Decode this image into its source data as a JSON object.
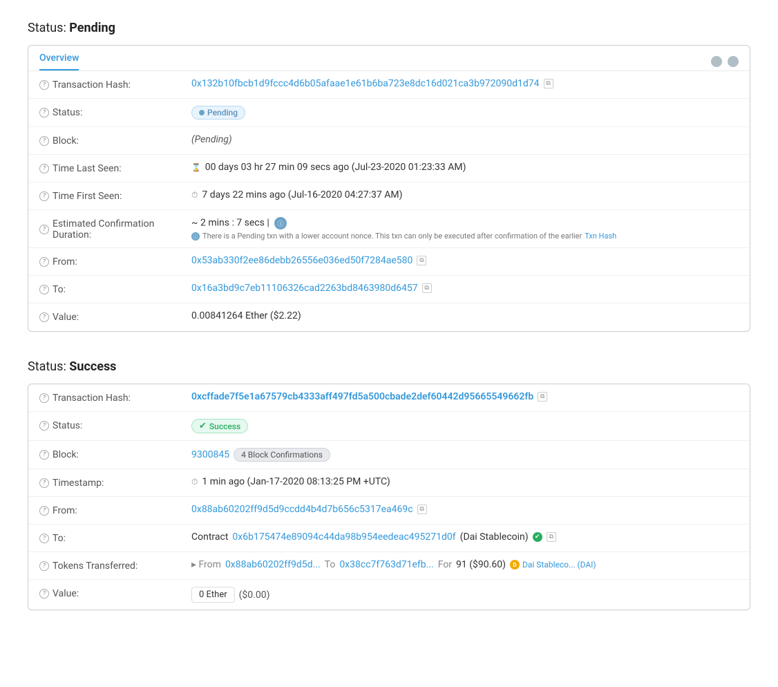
{
  "pending_section": {
    "title": "Status:",
    "title_bold": "Pending",
    "tab_label": "Overview",
    "transaction_hash_label": "Transaction Hash:",
    "transaction_hash_value": "0x132b10fbcb1d9fccc4d6b05afaae1e61b6ba723e8dc16d021ca3b972090d1d74",
    "status_label": "Status:",
    "status_value": "Pending",
    "block_label": "Block:",
    "block_value": "(Pending)",
    "time_last_seen_label": "Time Last Seen:",
    "time_last_seen_value": "00 days 03 hr 27 min 09 secs ago (Jul-23-2020 01:23:33 AM)",
    "time_first_seen_label": "Time First Seen:",
    "time_first_seen_value": "7 days 22 mins ago (Jul-16-2020 04:27:37 AM)",
    "est_confirmation_label": "Estimated Confirmation Duration:",
    "est_confirmation_value": "~ 2 mins : 7 secs |",
    "est_confirmation_note": "There is a Pending txn with a lower account nonce. This txn can only be executed after confirmation of the earlier",
    "est_confirmation_note_link": "Txn Hash",
    "from_label": "From:",
    "from_value": "0x53ab330f2ee86debb26556e036ed50f7284ae580",
    "to_label": "To:",
    "to_value": "0x16a3bd9c7eb11106326cad2263bd8463980d6457",
    "value_label": "Value:",
    "value_value": "0.00841264 Ether ($2.22)"
  },
  "success_section": {
    "title": "Status:",
    "title_bold": "Success",
    "transaction_hash_label": "Transaction Hash:",
    "transaction_hash_value": "0xcffade7f5e1a67579cb4333aff497fd5a500cbade2def60442d95665549662fb",
    "status_label": "Status:",
    "status_value": "Success",
    "block_label": "Block:",
    "block_number": "9300845",
    "block_confirmations": "4 Block Confirmations",
    "timestamp_label": "Timestamp:",
    "timestamp_value": "1 min ago (Jan-17-2020 08:13:25 PM +UTC)",
    "from_label": "From:",
    "from_value": "0x88ab60202ff9d5d9ccdd4b4d7b656c5317ea469c",
    "to_label": "To:",
    "to_prefix": "Contract",
    "to_contract": "0x6b175474e89094c44da98b954eedeac495271d0f",
    "to_name": "(Dai Stablecoin)",
    "tokens_transferred_label": "Tokens Transferred:",
    "tokens_from_prefix": "▸ From",
    "tokens_from": "0x88ab60202ff9d5d...",
    "tokens_to_prefix": "To",
    "tokens_to": "0x38cc7f763d71efb...",
    "tokens_for_prefix": "For",
    "tokens_amount": "91 ($90.60)",
    "tokens_name": "Dai Stableco... (DAI)",
    "value_label": "Value:",
    "value_amount": "0 Ether",
    "value_usd": "($0.00)"
  }
}
